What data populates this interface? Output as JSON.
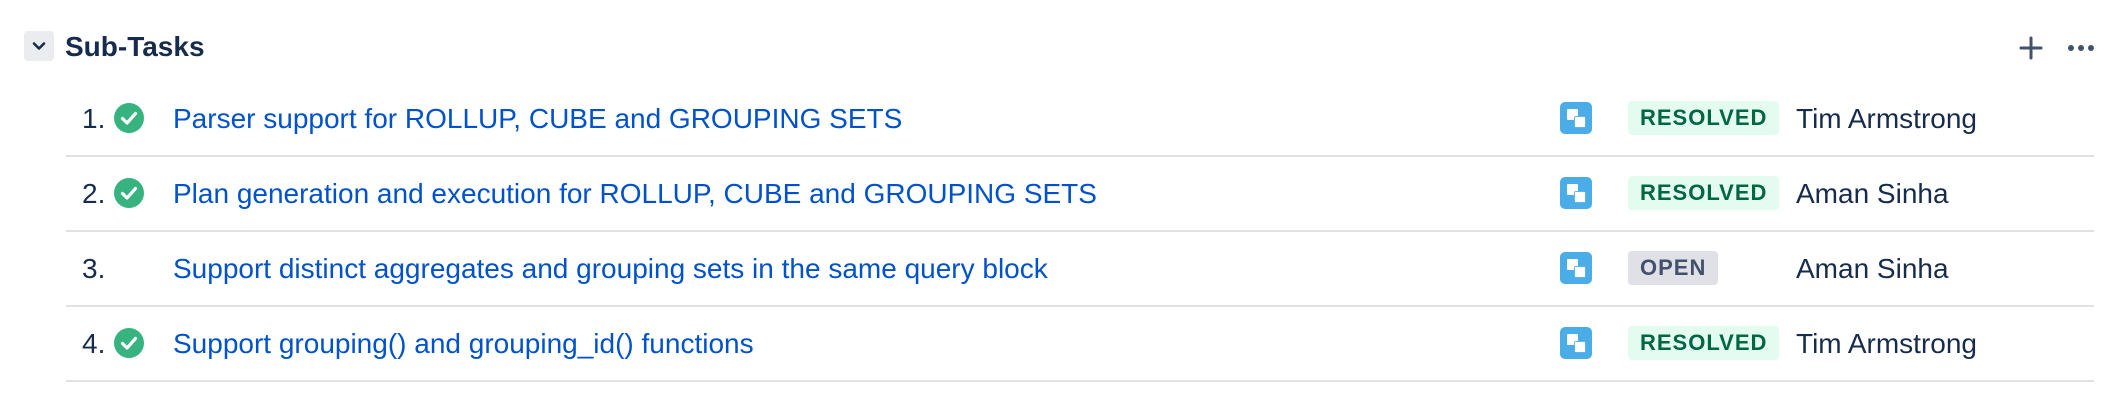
{
  "section": {
    "title": "Sub-Tasks",
    "toggle_icon": "chevron-down-icon",
    "actions": [
      {
        "icon": "plus-icon"
      },
      {
        "icon": "more-horizontal-icon"
      }
    ]
  },
  "colors": {
    "link": "#0052cc",
    "resolved_bg": "#e3fcef",
    "resolved_text": "#006644",
    "open_bg": "#dfe1e6",
    "open_text": "#42526e",
    "subtask_icon": "#4bade8",
    "check": "#36b37e"
  },
  "subtasks": [
    {
      "number": "1.",
      "done": true,
      "summary": "Parser support for ROLLUP, CUBE and GROUPING SETS",
      "type_icon": "subtask-icon",
      "status": "RESOLVED",
      "assignee": "Tim Armstrong"
    },
    {
      "number": "2.",
      "done": true,
      "summary": "Plan generation and execution for ROLLUP, CUBE and GROUPING SETS",
      "type_icon": "subtask-icon",
      "status": "RESOLVED",
      "assignee": "Aman Sinha"
    },
    {
      "number": "3.",
      "done": false,
      "summary": "Support distinct aggregates and grouping sets in the same query block",
      "type_icon": "subtask-icon",
      "status": "OPEN",
      "assignee": "Aman Sinha"
    },
    {
      "number": "4.",
      "done": true,
      "summary": "Support grouping() and grouping_id() functions",
      "type_icon": "subtask-icon",
      "status": "RESOLVED",
      "assignee": "Tim Armstrong"
    }
  ]
}
